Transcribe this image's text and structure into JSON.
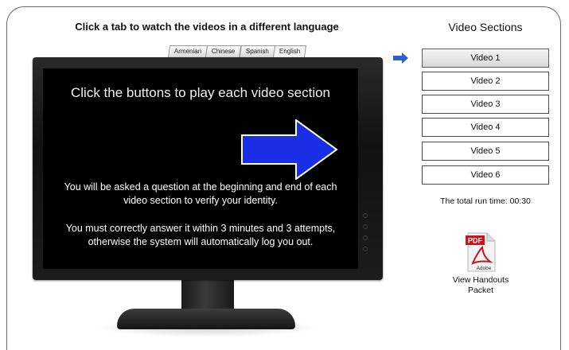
{
  "header": {
    "instruction": "Click a tab to watch the videos in a different language"
  },
  "language_tabs": [
    {
      "label": "Armenian"
    },
    {
      "label": "Chinese"
    },
    {
      "label": "Spanish"
    },
    {
      "label": "English",
      "active": true
    }
  ],
  "screen": {
    "title": "Click the buttons to play each video section",
    "paragraph1": "You will be asked a question at the beginning and end of each video section to verify your identity.",
    "paragraph2": "You must correctly answer it within 3 minutes and 3 attempts, otherwise the system will automatically log you out.",
    "arrow_color": "#1a2ee6",
    "arrow_icon": "right-arrow-icon"
  },
  "sections": {
    "title": "Video Sections",
    "pointer_color": "#2f5fd3",
    "pointer_icon": "arrow-pointer-icon",
    "videos": [
      {
        "label": "Video 1",
        "active": true
      },
      {
        "label": "Video 2"
      },
      {
        "label": "Video 3"
      },
      {
        "label": "Video 4"
      },
      {
        "label": "Video 5"
      },
      {
        "label": "Video 6"
      }
    ],
    "runtime": "The total run time: 00:30"
  },
  "handouts": {
    "icon": "pdf-icon",
    "pdf_badge": "PDF",
    "brand": "Adobe",
    "label": "View Handouts Packet"
  }
}
